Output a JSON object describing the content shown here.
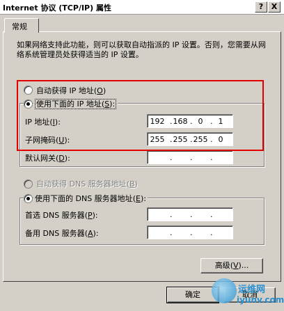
{
  "window": {
    "title": "Internet 协议 (TCP/IP) 属性",
    "help_button": "?",
    "close_button": "X"
  },
  "tabs": [
    {
      "label": "常规"
    }
  ],
  "description": "如果网络支持此功能，则可以获取自动指派的 IP 设置。否则，您需要从网络系统管理员处获得适当的 IP 设置。",
  "ip_section": {
    "auto_label": "自动获得 IP 地址",
    "auto_key": "O",
    "manual_label": "使用下面的 IP 地址",
    "manual_key": "S",
    "selected": "manual",
    "fields": [
      {
        "label": "IP 地址",
        "key": "I",
        "octets": [
          "192",
          "168",
          "0",
          "1"
        ]
      },
      {
        "label": "子网掩码",
        "key": "U",
        "octets": [
          "255",
          "255",
          "255",
          "0"
        ]
      },
      {
        "label": "默认网关",
        "key": "D",
        "octets": [
          "",
          "",
          "",
          ""
        ]
      }
    ]
  },
  "dns_section": {
    "auto_label": "自动获得 DNS 服务器地址",
    "auto_key": "B",
    "manual_label": "使用下面的 DNS 服务器地址",
    "manual_key": "E",
    "selected": "manual",
    "fields": [
      {
        "label": "首选 DNS 服务器",
        "key": "P",
        "octets": [
          "",
          "",
          "",
          ""
        ]
      },
      {
        "label": "备用 DNS 服务器",
        "key": "A",
        "octets": [
          "",
          "",
          "",
          ""
        ]
      }
    ]
  },
  "buttons": {
    "advanced": "高级",
    "advanced_key": "V",
    "ok": "确定",
    "cancel": "取消"
  },
  "watermark": {
    "line1": "运维网",
    "line2": "iyunv.com"
  },
  "colors": {
    "dialog_bg": "#d4d0c8",
    "highlight_box": "#e00000"
  }
}
